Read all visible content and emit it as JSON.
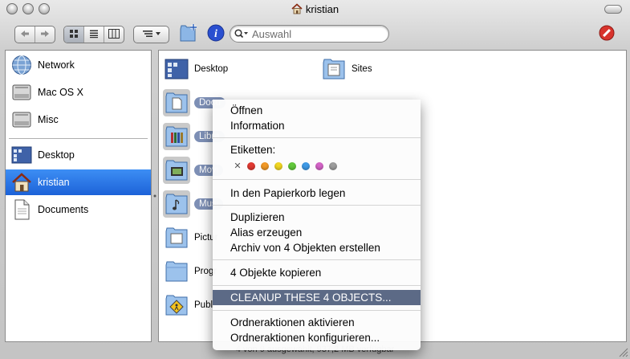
{
  "window": {
    "title": "kristian"
  },
  "toolbar": {
    "search_placeholder": "Auswahl"
  },
  "sidebar": {
    "devices": [
      {
        "label": "Network",
        "icon": "network-globe-icon"
      },
      {
        "label": "Mac OS X",
        "icon": "hard-drive-icon"
      },
      {
        "label": "Misc",
        "icon": "hard-drive-icon"
      }
    ],
    "places": [
      {
        "label": "Desktop",
        "icon": "desktop-icon"
      },
      {
        "label": "kristian",
        "icon": "home-icon",
        "selected": true
      },
      {
        "label": "Documents",
        "icon": "document-icon"
      }
    ]
  },
  "main": {
    "items": [
      {
        "label": "Desktop",
        "icon": "desktop-folder-icon"
      },
      {
        "label": "Sites",
        "icon": "sites-folder-icon"
      },
      {
        "label": "Docu",
        "icon": "documents-folder-icon",
        "selected": true
      },
      {
        "label": "Libra",
        "icon": "library-folder-icon",
        "selected": true
      },
      {
        "label": "Movi",
        "icon": "movies-folder-icon",
        "selected": true
      },
      {
        "label": "Musi",
        "icon": "music-folder-icon",
        "selected": true
      },
      {
        "label": "Pictur",
        "icon": "pictures-folder-icon"
      },
      {
        "label": "Progr",
        "icon": "folder-icon"
      },
      {
        "label": "Publi",
        "icon": "public-folder-icon"
      }
    ]
  },
  "status": {
    "text": "4 von 9 ausgewählt, 937,2 MB verfügbar"
  },
  "context_menu": {
    "open": "Öffnen",
    "info": "Information",
    "labels_heading": "Etiketten:",
    "label_colors": [
      "#e23a32",
      "#f39a27",
      "#f2d722",
      "#62c93c",
      "#3f9be8",
      "#d564c8",
      "#9e9e9e"
    ],
    "trash": "In den Papierkorb legen",
    "duplicate": "Duplizieren",
    "alias": "Alias erzeugen",
    "archive": "Archiv von 4 Objekten erstellen",
    "copy": "4 Objekte kopieren",
    "cleanup": "CLEANUP THESE 4 OBJECTS...",
    "enable_actions": "Ordneraktionen aktivieren",
    "configure_actions": "Ordneraktionen konfigurieren..."
  },
  "colors": {
    "selection": "#1c62d8",
    "menu_highlight": "#5c6a86",
    "file_selection_label": "#7d8fb5",
    "info_button": "#2a4fd0",
    "stop_button": "#d8332c"
  }
}
